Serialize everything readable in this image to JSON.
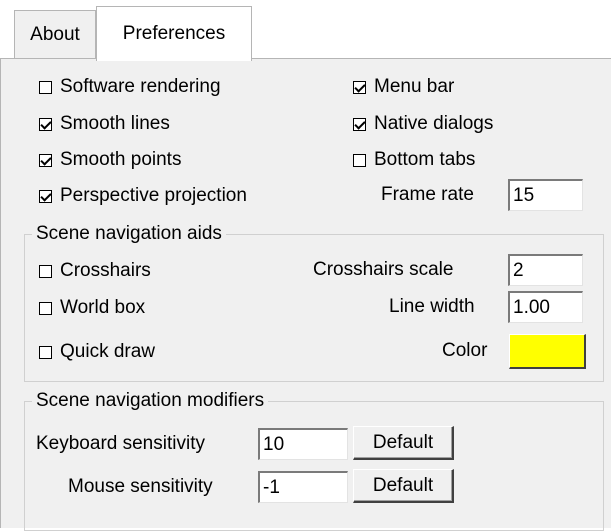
{
  "tabs": [
    {
      "label": "About",
      "active": false
    },
    {
      "label": "Preferences",
      "active": true
    }
  ],
  "general": {
    "left_options": [
      {
        "label": "Software rendering",
        "checked": false
      },
      {
        "label": "Smooth lines",
        "checked": true
      },
      {
        "label": "Smooth points",
        "checked": true
      },
      {
        "label": "Perspective projection",
        "checked": true
      }
    ],
    "right_options": [
      {
        "label": "Menu bar",
        "checked": true
      },
      {
        "label": "Native dialogs",
        "checked": true
      },
      {
        "label": "Bottom tabs",
        "checked": false
      }
    ],
    "frame_rate_label": "Frame rate",
    "frame_rate_value": "15"
  },
  "navigation_aids": {
    "title": "Scene navigation aids",
    "options": [
      {
        "label": "Crosshairs",
        "checked": false
      },
      {
        "label": "World box",
        "checked": false
      },
      {
        "label": "Quick draw",
        "checked": false
      }
    ],
    "crosshairs_scale_label": "Crosshairs scale",
    "crosshairs_scale_value": "2",
    "line_width_label": "Line width",
    "line_width_value": "1.00",
    "color_label": "Color",
    "color_value": "#ffff00"
  },
  "navigation_modifiers": {
    "title": "Scene navigation modifiers",
    "keyboard_label": "Keyboard sensitivity",
    "keyboard_value": "10",
    "mouse_label": "Mouse sensitivity",
    "mouse_value": "-1",
    "default_label": "Default"
  }
}
